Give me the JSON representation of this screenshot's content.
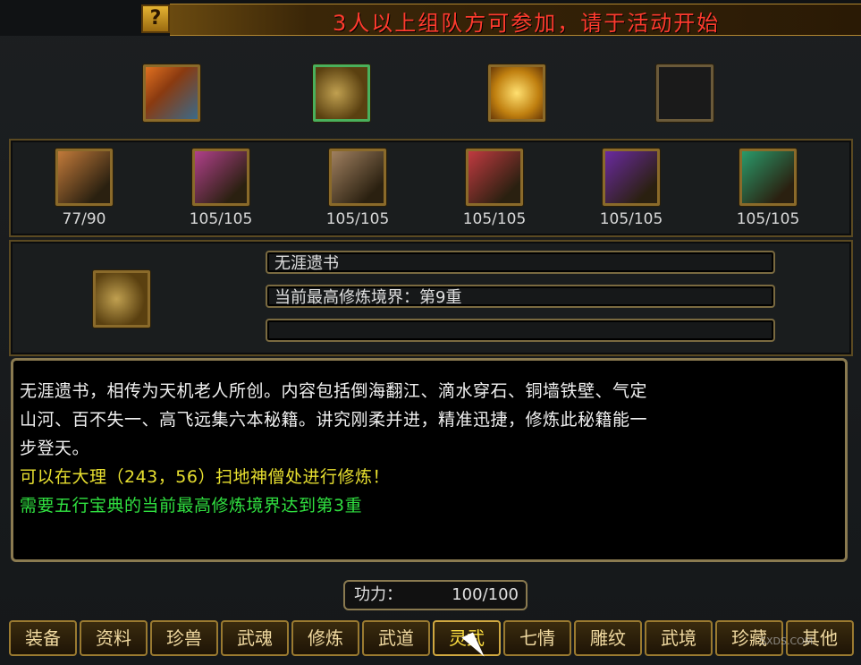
{
  "banner": {
    "text": "3人以上组队方可参加，请于活动开始"
  },
  "help": {
    "label": "?"
  },
  "top_icons": [
    {
      "name": "golden-book-icon",
      "color": "#c0842a"
    },
    {
      "name": "scroll-bundle-icon",
      "color": "#6a5a2a"
    },
    {
      "name": "gold-treasure-icon",
      "color": "#e0a020"
    },
    {
      "name": "empty-slot-icon",
      "color": "#222"
    }
  ],
  "skill_books": [
    {
      "count": "77/90",
      "color": "#c27a3a"
    },
    {
      "count": "105/105",
      "color": "#b0408a"
    },
    {
      "count": "105/105",
      "color": "#a08060"
    },
    {
      "count": "105/105",
      "color": "#c03a40"
    },
    {
      "count": "105/105",
      "color": "#6a2aa0"
    },
    {
      "count": "105/105",
      "color": "#2a9a6a"
    }
  ],
  "detail": {
    "name": "无涯遗书",
    "realm": "当前最高修炼境界：第9重",
    "extra": ""
  },
  "description": {
    "line1": "无涯遗书，相传为天机老人所创。内容包括倒海翻江、滴水穿石、铜墙铁壁、气定",
    "line2": "山河、百不失一、高飞远集六本秘籍。讲究刚柔并进，精准迅捷，修炼此秘籍能一",
    "line3": "步登天。",
    "line4": "可以在大理（243，56）扫地神僧处进行修炼！",
    "line5": "需要五行宝典的当前最高修炼境界达到第3重"
  },
  "power": {
    "label": "功力：",
    "value": "100/100"
  },
  "tabs": [
    "装备",
    "资料",
    "珍兽",
    "武魂",
    "修炼",
    "武道",
    "灵武",
    "七情",
    "雕纹",
    "武境",
    "珍藏",
    "其他"
  ],
  "watermark": "SXDS.COM"
}
